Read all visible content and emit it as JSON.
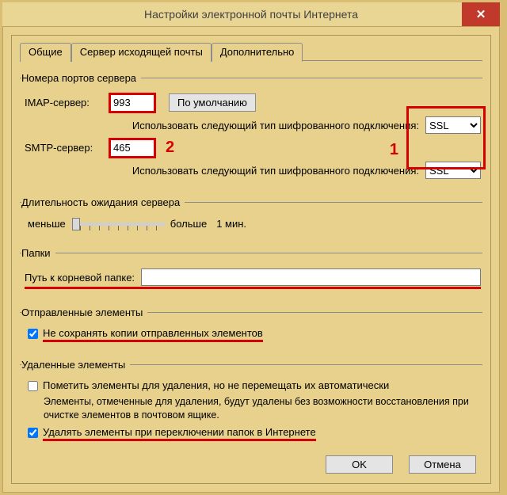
{
  "window": {
    "title": "Настройки электронной почты Интернета"
  },
  "tabs": {
    "general": "Общие",
    "outgoing": "Сервер исходящей почты",
    "advanced": "Дополнительно"
  },
  "ports": {
    "legend": "Номера портов сервера",
    "imap_label": "IMAP-сервер:",
    "imap_value": "993",
    "default_btn": "По умолчанию",
    "enc_label": "Использовать следующий тип шифрованного подключения:",
    "enc_imap": "SSL",
    "smtp_label": "SMTP-сервер:",
    "smtp_value": "465",
    "enc_smtp": "SSL"
  },
  "timeout": {
    "legend": "Длительность ожидания сервера",
    "less": "меньше",
    "more": "больше",
    "value": "1 мин."
  },
  "folders": {
    "legend": "Папки",
    "root_label": "Путь к корневой папке:",
    "root_value": ""
  },
  "sent": {
    "legend": "Отправленные элементы",
    "nosave": "Не сохранять копии отправленных элементов"
  },
  "deleted": {
    "legend": "Удаленные элементы",
    "mark": "Пометить элементы для удаления, но не перемещать их автоматически",
    "note": "Элементы, отмеченные для удаления, будут удалены без возможности восстановления при очистке элементов в почтовом ящике.",
    "purge": "Удалять элементы при переключении папок в Интернете"
  },
  "dialog": {
    "ok": "OK",
    "cancel": "Отмена"
  },
  "annotations": {
    "one": "1",
    "two": "2"
  }
}
